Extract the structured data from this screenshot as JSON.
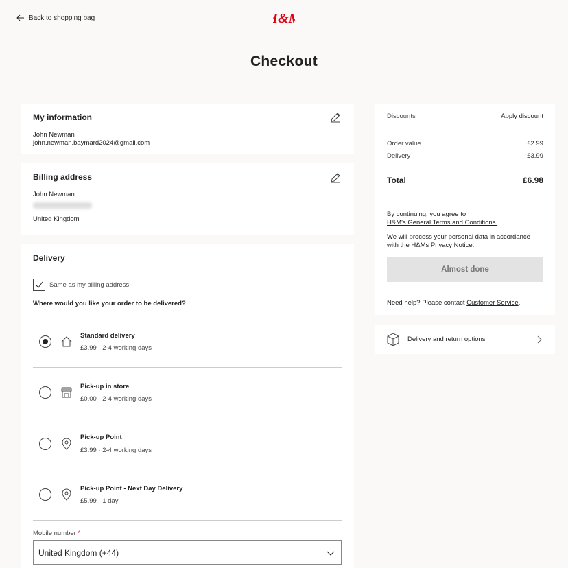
{
  "header": {
    "back_label": "Back to shopping bag",
    "brand": "H&M",
    "brand_color": "#e50010",
    "page_title": "Checkout"
  },
  "my_information": {
    "title": "My information",
    "name": "John Newman",
    "email": "john.newman.baymard2024@gmail.com"
  },
  "billing_address": {
    "title": "Billing address",
    "name": "John Newman",
    "country": "United Kingdom"
  },
  "delivery": {
    "title": "Delivery",
    "same_as_billing_label": "Same as my billing address",
    "same_as_billing_checked": true,
    "question": "Where would you like your order to be delivered?",
    "options": [
      {
        "label": "Standard delivery",
        "detail": "£3.99 · 2-4 working days",
        "icon": "house-icon",
        "selected": true
      },
      {
        "label": "Pick-up in store",
        "detail": "£0.00 · 2-4 working days",
        "icon": "store-icon",
        "selected": false
      },
      {
        "label": "Pick-up Point",
        "detail": "£3.99 · 2-4 working days",
        "icon": "location-pin-icon",
        "selected": false
      },
      {
        "label": "Pick-up Point - Next Day Delivery",
        "detail": "£5.99 · 1 day",
        "icon": "location-pin-icon",
        "selected": false
      }
    ],
    "mobile_label": "Mobile number",
    "required_marker": "*",
    "country_code_value": "United Kingdom (+44)"
  },
  "summary": {
    "discounts_label": "Discounts",
    "apply_discount_label": "Apply discount",
    "order_value_label": "Order value",
    "order_value": "£2.99",
    "delivery_label": "Delivery",
    "delivery_value": "£3.99",
    "total_label": "Total",
    "total_value": "£6.98",
    "terms_prefix": "By continuing, you agree to",
    "terms_link": "H&M's General Terms and Conditions.",
    "privacy_prefix": "We will process your personal data in accordance",
    "privacy_prefix2": "with the H&Ms ",
    "privacy_link": "Privacy Notice",
    "privacy_suffix": ".",
    "cta_label": "Almost done",
    "help_prefix": "Need help? Please contact ",
    "help_link": "Customer Service",
    "help_suffix": "."
  },
  "delivery_info": {
    "label": "Delivery and return options",
    "icon": "box-icon"
  }
}
